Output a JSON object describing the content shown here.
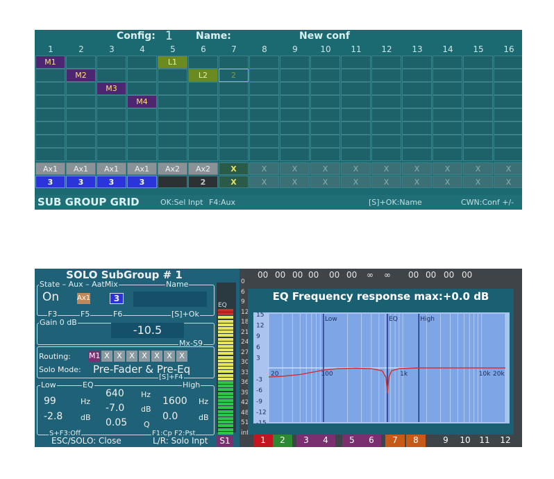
{
  "grid": {
    "config_label": "Config:",
    "config_value": "1",
    "name_label": "Name:",
    "name_value": "New conf",
    "columns": [
      "1",
      "2",
      "3",
      "4",
      "5",
      "6",
      "7",
      "8",
      "9",
      "10",
      "11",
      "12",
      "13",
      "14",
      "15",
      "16"
    ],
    "assignments": [
      {
        "col": 0,
        "row": 0,
        "text": "M1",
        "kind": "m"
      },
      {
        "col": 1,
        "row": 1,
        "text": "M2",
        "kind": "m"
      },
      {
        "col": 2,
        "row": 2,
        "text": "M3",
        "kind": "m"
      },
      {
        "col": 3,
        "row": 3,
        "text": "M4",
        "kind": "m"
      },
      {
        "col": 4,
        "row": 0,
        "text": "L1",
        "kind": "l"
      },
      {
        "col": 5,
        "row": 1,
        "text": "L2",
        "kind": "l"
      },
      {
        "col": 6,
        "row": 1,
        "text": "2",
        "kind": "lx"
      }
    ],
    "aux_row": [
      "Ax1",
      "Ax1",
      "Ax1",
      "Ax1",
      "Ax2",
      "Ax2",
      "X",
      "X",
      "X",
      "X",
      "X",
      "X",
      "X",
      "X",
      "X",
      "X"
    ],
    "input_row": [
      "3",
      "3",
      "3",
      "3",
      "",
      "2",
      "X",
      "X",
      "X",
      "X",
      "X",
      "X",
      "X",
      "X",
      "X",
      "X"
    ],
    "footer": {
      "title": "SUB GROUP GRID",
      "hint1": "OK:Sel Inpt",
      "hint2": "F4:Aux",
      "hint3": "[S]+OK:Name",
      "hint4": "CWN:Conf +/-"
    }
  },
  "solo": {
    "title": "SOLO SubGroup # 1",
    "state_header": "State – Aux – AatMix",
    "name_header": "Name",
    "state_value": "On",
    "aux_value": "Ax1",
    "mix_value": "3",
    "f3": "F3",
    "f5": "F5",
    "f6": "F6",
    "sok": "[S]+Ok",
    "gain_label": "Gain 0 dB",
    "gain_value": "-10.5",
    "mx_label": "Mx-S9",
    "routing_label": "Routing:",
    "routing": [
      "M1",
      "X",
      "X",
      "X",
      "X",
      "X",
      "X",
      "X"
    ],
    "solo_mode_label": "Solo Mode:",
    "solo_mode_value": "Pre-Fader & Pre-Eq",
    "sf4": "[S]+F4",
    "eq_low": "Low",
    "eq_label": "EQ",
    "eq_high": "High",
    "low_freq": "99",
    "hz1": "Hz",
    "low_gain": "-2.8",
    "db1": "dB",
    "mid_freq": "640",
    "hz2": "Hz",
    "mid_gain": "-7.0",
    "db2": "dB",
    "mid_q": "0.05",
    "q": "Q",
    "high_freq": "1600",
    "hz3": "Hz",
    "high_gain": "0.0",
    "db3": "dB",
    "sf3": "S+F3:Off",
    "f1f2": "F1:Cp   F2:Pst",
    "bottom_left": "ESC/SOLO: Close",
    "bottom_right": "L/R: Solo Inpt",
    "s1": "S1",
    "eq_tag": "EQ",
    "meter_ticks": [
      "0",
      "6",
      "9",
      "12",
      "18",
      "21",
      "24",
      "27",
      "30",
      "33",
      "36",
      "39",
      "42",
      "48",
      "51",
      "inf"
    ]
  },
  "mixer": {
    "header_values": [
      "00",
      "00",
      "00",
      "00",
      "00",
      "00",
      "∞",
      "∞",
      "00",
      "00",
      "00",
      "00"
    ],
    "channels": [
      "1",
      "2",
      "3",
      "4",
      "5",
      "6",
      "7",
      "8",
      "9",
      "10",
      "11",
      "12"
    ],
    "channel_colors": [
      "#c01820",
      "#2c8a30",
      "#7a3070",
      "#7a3070",
      "#7a3070",
      "#7a3070",
      "#c85a18",
      "#c85a18",
      "#3f4448",
      "#3f4448",
      "#3f4448",
      "#3f4448"
    ]
  },
  "eq": {
    "title": "EQ Frequency response max:+0.0 dB",
    "y_ticks": [
      "15",
      "12",
      "9",
      "6",
      "3",
      "-3",
      "-6",
      "-9",
      "-12",
      "-15"
    ],
    "x_ticks": [
      "20",
      "100",
      "1k",
      "10k",
      "20k"
    ],
    "band_labels": [
      "Low",
      "EQ",
      "High"
    ],
    "curve_color": "#d03030"
  },
  "chart_data": {
    "type": "line",
    "title": "EQ Frequency response max:+0.0 dB",
    "xlabel": "",
    "ylabel": "",
    "xscale": "log",
    "xlim": [
      20,
      20000
    ],
    "ylim": [
      -15,
      15
    ],
    "x_ticks": [
      20,
      100,
      1000,
      10000,
      20000
    ],
    "y_ticks": [
      15,
      12,
      9,
      6,
      3,
      -3,
      -6,
      -9,
      -12,
      -15
    ],
    "band_markers": {
      "Low": 99,
      "EQ": 640,
      "High": 1600
    },
    "x": [
      20,
      30,
      50,
      80,
      99,
      150,
      250,
      400,
      550,
      610,
      630,
      640,
      650,
      670,
      720,
      900,
      1600,
      5000,
      20000
    ],
    "y": [
      -2.5,
      -2.3,
      -1.8,
      -1.0,
      -0.6,
      -0.2,
      -0.1,
      -0.2,
      -0.8,
      -2.5,
      -5.0,
      -7.0,
      -5.0,
      -2.5,
      -0.8,
      -0.2,
      0.0,
      0.0,
      0.0
    ]
  }
}
